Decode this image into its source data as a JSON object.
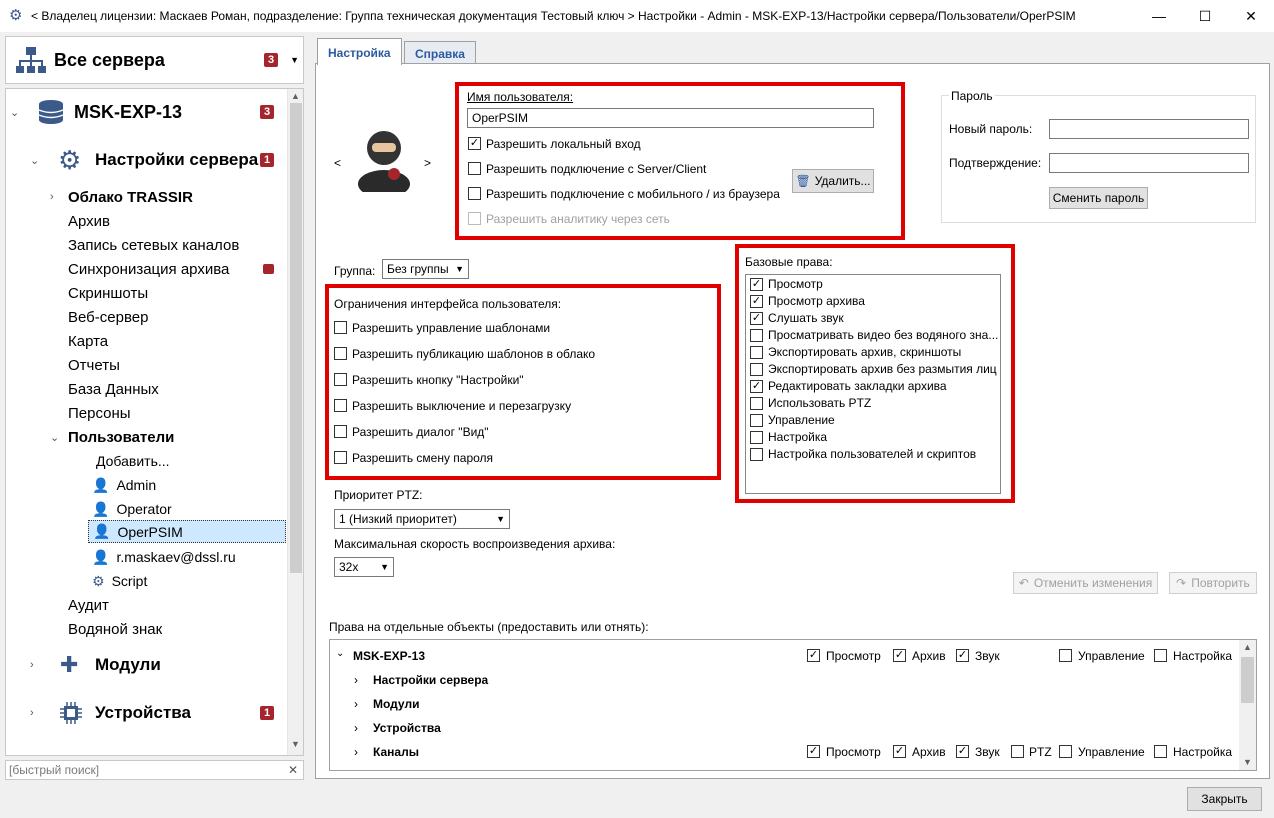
{
  "window": {
    "title": "< Владелец лицензии: Маскаев Роман, подразделение: Группа техническая документация Тестовый ключ > Настройки - Admin - MSK-EXP-13/Настройки сервера/Пользователи/OperPSIM"
  },
  "left": {
    "header": {
      "title": "Все сервера",
      "badge": "3"
    },
    "tree": {
      "server": {
        "label": "MSK-EXP-13",
        "badge": "3"
      },
      "settings": {
        "label": "Настройки сервера",
        "badge": "1"
      },
      "items": [
        "Облако TRASSIR",
        "Архив",
        "Запись сетевых каналов",
        "Синхронизация архива",
        "Скриншоты",
        "Веб-сервер",
        "Карта",
        "Отчеты",
        "База Данных",
        "Персоны"
      ],
      "users": "Пользователи",
      "user_items": [
        "Добавить...",
        "Admin",
        "Operator",
        "OperPSIM",
        "r.maskaev@dssl.ru",
        "Script"
      ],
      "after": [
        "Аудит",
        "Водяной знак"
      ],
      "modules": "Модули",
      "devices": {
        "label": "Устройства",
        "badge": "1"
      }
    },
    "search_placeholder": "[быстрый поиск]"
  },
  "tabs": [
    "Настройка",
    "Справка"
  ],
  "user": {
    "name_label": "Имя пользователя:",
    "name_value": "OperPSIM",
    "options": [
      {
        "label": "Разрешить локальный вход",
        "checked": true,
        "disabled": false
      },
      {
        "label": "Разрешить подключение с Server/Client",
        "checked": false,
        "disabled": false
      },
      {
        "label": "Разрешить подключение с мобильного / из браузера",
        "checked": false,
        "disabled": false
      },
      {
        "label": "Разрешить аналитику через сеть",
        "checked": false,
        "disabled": true
      }
    ],
    "delete_label": "Удалить..."
  },
  "password": {
    "title": "Пароль",
    "new_label": "Новый пароль:",
    "confirm_label": "Подтверждение:",
    "change_label": "Сменить пароль"
  },
  "group": {
    "label": "Группа:",
    "value": "Без группы"
  },
  "restrictions": {
    "title": "Ограничения интерфейса пользователя:",
    "items": [
      "Разрешить управление шаблонами",
      "Разрешить публикацию шаблонов в облако",
      "Разрешить кнопку \"Настройки\"",
      "Разрешить выключение и перезагрузку",
      "Разрешить диалог \"Вид\"",
      "Разрешить смену пароля"
    ]
  },
  "rights": {
    "title": "Базовые права:",
    "items": [
      {
        "label": "Просмотр",
        "checked": true
      },
      {
        "label": "Просмотр архива",
        "checked": true
      },
      {
        "label": "Слушать звук",
        "checked": true
      },
      {
        "label": "Просматривать видео без водяного зна...",
        "checked": false
      },
      {
        "label": "Экспортировать архив, скриншоты",
        "checked": false
      },
      {
        "label": "Экспортировать архив без размытия лиц",
        "checked": false
      },
      {
        "label": "Редактировать закладки архива",
        "checked": true
      },
      {
        "label": "Использовать PTZ",
        "checked": false
      },
      {
        "label": "Управление",
        "checked": false
      },
      {
        "label": "Настройка",
        "checked": false
      },
      {
        "label": "Настройка пользователей и скриптов",
        "checked": false
      }
    ]
  },
  "ptz": {
    "label": "Приоритет PTZ:",
    "value": "1 (Низкий приоритет)"
  },
  "speed": {
    "label": "Максимальная скорость воспроизведения архива:",
    "value": "32x"
  },
  "actions": {
    "undo": "Отменить изменения",
    "redo": "Повторить"
  },
  "objects": {
    "title": "Права на отдельные объекты (предоставить или отнять):",
    "root": "MSK-EXP-13",
    "children": [
      "Настройки сервера",
      "Модули",
      "Устройства",
      "Каналы"
    ],
    "perm_view": "Просмотр",
    "perm_archive": "Архив",
    "perm_sound": "Звук",
    "perm_ptz": "PTZ",
    "perm_manage": "Управление",
    "perm_settings": "Настройка"
  },
  "close_label": "Закрыть"
}
